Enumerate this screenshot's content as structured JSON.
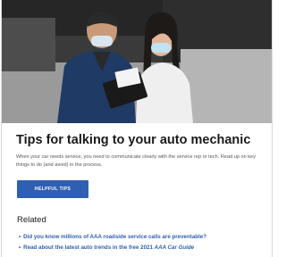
{
  "article": {
    "title": "Tips for talking to your auto mechanic",
    "description": "When your car needs service, you need to communicate clearly with the service rep or tech. Read up on key things to do (and avoid) in the process.",
    "button_label": "HELPFUL TIPS"
  },
  "related": {
    "heading": "Related",
    "links": [
      {
        "text": "Did you know millions of AAA roadside service calls are preventable?"
      },
      {
        "text": "Read about the latest auto trends in the free 2021 ",
        "italic": "AAA Car Guide"
      }
    ]
  },
  "colors": {
    "accent": "#2f5fb3",
    "title": "#1a1a1a"
  },
  "hero": {
    "icon": "mechanic-photo"
  }
}
